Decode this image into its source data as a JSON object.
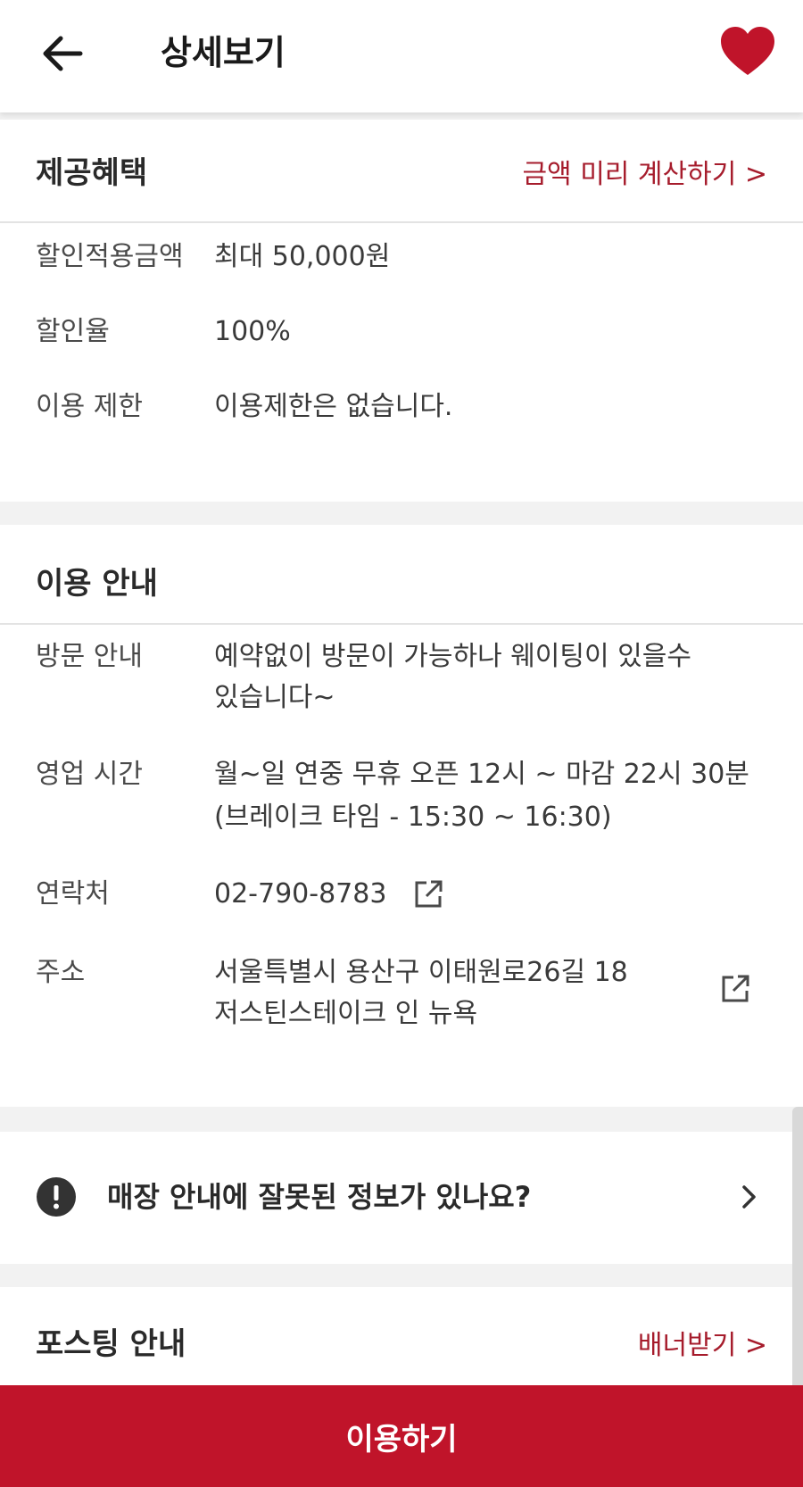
{
  "header": {
    "title": "상세보기",
    "back_icon": "arrow-left-icon",
    "favorite_icon": "heart-icon",
    "favorite_color": "#c0142a"
  },
  "benefits": {
    "title": "제공혜택",
    "link_label": "금액 미리 계산하기 >",
    "rows": [
      {
        "label": "할인적용금액",
        "value": "최대 50,000원"
      },
      {
        "label": "할인율",
        "value": "100%"
      },
      {
        "label": "이용 제한",
        "value": "이용제한은 없습니다."
      }
    ]
  },
  "usage": {
    "title": "이용 안내",
    "rows": [
      {
        "label": "방문 안내",
        "value_lines": [
          "예약없이 방문이 가능하나 웨이팅이 있을수",
          "있습니다~"
        ]
      },
      {
        "label": "영업 시간",
        "value_lines": [
          "월~일 연중 무휴 오픈 12시 ~ 마감 22시 30분",
          "(브레이크 타임 - 15:30 ~ 16:30)"
        ]
      },
      {
        "label": "연락처",
        "value": "02-790-8783"
      },
      {
        "label": "주소",
        "value_lines": [
          "서울특별시 용산구 이태원로26길 18",
          "저스틴스테이크 인 뉴욕"
        ]
      }
    ]
  },
  "report": {
    "text": "매장 안내에 잘못된 정보가 있나요?"
  },
  "posting": {
    "title": "포스팅 안내",
    "link_label": "배너받기 >"
  },
  "cta": {
    "label": "이용하기",
    "color": "#c0142a"
  },
  "accent_color": "#a61c2c"
}
